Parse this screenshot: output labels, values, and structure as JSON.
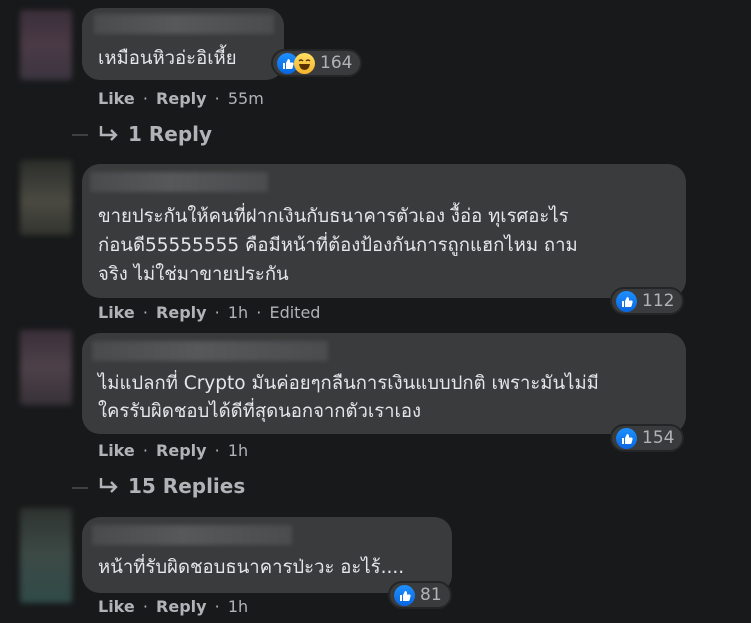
{
  "comments": [
    {
      "text_lines": [
        "เหมือนหิวอ่ะอิเหี้ย"
      ],
      "reactions": [
        "like-icon",
        "haha-icon"
      ],
      "reaction_count": "164",
      "like": "Like",
      "reply": "Reply",
      "time": "55m",
      "edited": ""
    },
    {
      "text_lines": [
        "ขายประกันให้คนที่ฝากเงินกับธนาคารตัวเอง งื้อ่อ ทุเรศอะไร",
        "ก่อนดี55555555 คือมีหน้าที่ต้องป้องกันการถูกแฮกไหม ถาม",
        "จริง ไม่ใช่มาขายประกัน"
      ],
      "reactions": [
        "like-icon"
      ],
      "reaction_count": "112",
      "like": "Like",
      "reply": "Reply",
      "time": "1h",
      "edited": "Edited"
    },
    {
      "text_lines": [
        "ไม่แปลกที่ Crypto มันค่อยๆกลืนการเงินแบบปกติ เพราะมันไม่มี",
        "ใครรับผิดชอบได้ดีที่สุดนอกจากตัวเราเอง"
      ],
      "reactions": [
        "like-icon"
      ],
      "reaction_count": "154",
      "like": "Like",
      "reply": "Reply",
      "time": "1h",
      "edited": ""
    },
    {
      "text_lines": [
        "หน้าที่รับผิดชอบธนาคารป่ะวะ อะไร้...."
      ],
      "reactions": [
        "like-icon"
      ],
      "reaction_count": "81",
      "like": "Like",
      "reply": "Reply",
      "time": "1h",
      "edited": ""
    }
  ],
  "reply_links": [
    {
      "label": "1 Reply"
    },
    {
      "label": "15 Replies"
    }
  ],
  "colors": {
    "background": "#18191a",
    "bubble": "#3a3b3c",
    "text": "#e4e6eb",
    "secondary_text": "#b0b3b8",
    "like_blue": "#1877f2"
  }
}
